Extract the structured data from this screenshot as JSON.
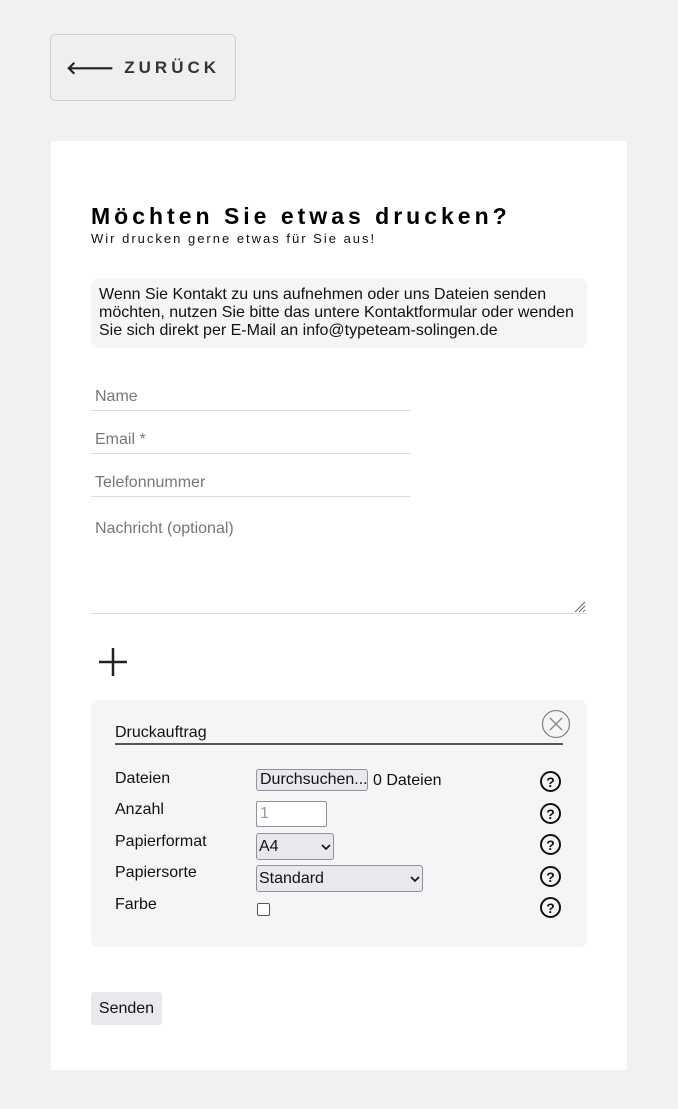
{
  "nav": {
    "back_label": "ZURÜCK",
    "back_icon": "arrow-left-icon"
  },
  "header": {
    "title": "Möchten Sie etwas drucken?",
    "subtitle": "Wir drucken gerne etwas für Sie aus!"
  },
  "info_text": "Wenn Sie Kontakt zu uns aufnehmen oder uns Dateien senden möchten, nutzen Sie bitte das untere Kontaktformular oder wenden Sie sich direkt per E-Mail an info@typeteam-solingen.de",
  "form": {
    "name_placeholder": "Name",
    "email_placeholder": "Email *",
    "phone_placeholder": "Telefonnummer",
    "message_placeholder": "Nachricht (optional)"
  },
  "print_job": {
    "title": "Druckauftrag",
    "files_label": "Dateien",
    "files_button": "Durchsuchen...",
    "files_count": "0 Dateien",
    "quantity_label": "Anzahl",
    "quantity_placeholder": "1",
    "paper_format_label": "Papierformat",
    "paper_format_value": "A4",
    "paper_type_label": "Papiersorte",
    "paper_type_value": "Standard",
    "color_label": "Farbe",
    "color_checked": false,
    "help_glyph": "?"
  },
  "submit_label": "Senden"
}
